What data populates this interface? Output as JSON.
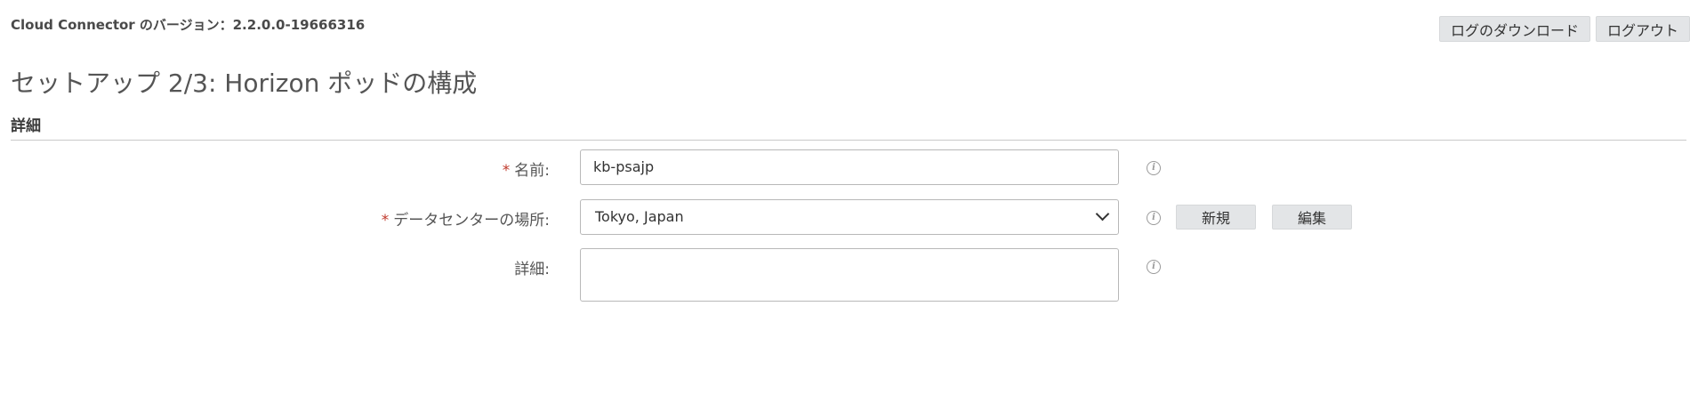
{
  "header": {
    "version_text": "Cloud Connector のバージョン：2.2.0.0-19666316",
    "download_logs_label": "ログのダウンロード",
    "logout_label": "ログアウト"
  },
  "page": {
    "title": "セットアップ 2/3: Horizon ポッドの構成",
    "section_title": "詳細"
  },
  "form": {
    "required_mark": "*",
    "name": {
      "label": "名前:",
      "value": "kb-psajp"
    },
    "datacenter": {
      "label": "データセンターの場所:",
      "selected": "Tokyo, Japan",
      "new_label": "新規",
      "edit_label": "編集"
    },
    "description": {
      "label": "詳細:",
      "value": ""
    },
    "info_glyph": "i"
  }
}
